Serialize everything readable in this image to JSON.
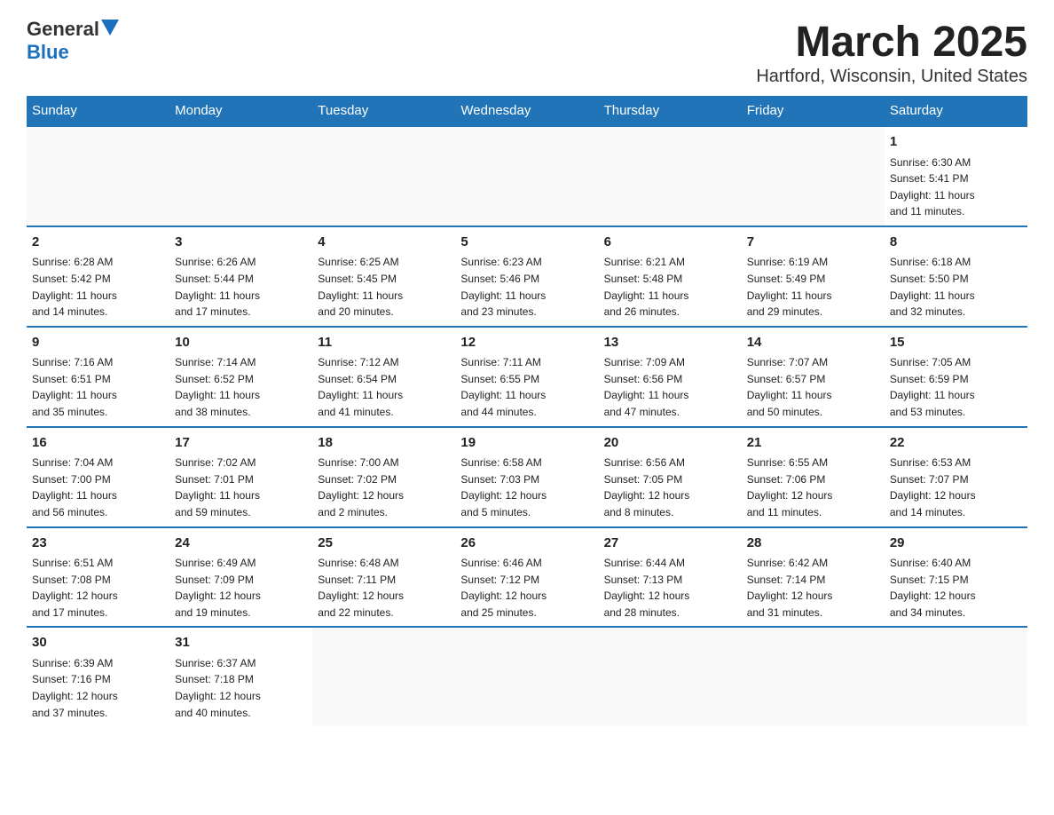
{
  "logo": {
    "general": "General",
    "blue": "Blue"
  },
  "title": "March 2025",
  "subtitle": "Hartford, Wisconsin, United States",
  "days_of_week": [
    "Sunday",
    "Monday",
    "Tuesday",
    "Wednesday",
    "Thursday",
    "Friday",
    "Saturday"
  ],
  "weeks": [
    [
      {
        "num": "",
        "info": ""
      },
      {
        "num": "",
        "info": ""
      },
      {
        "num": "",
        "info": ""
      },
      {
        "num": "",
        "info": ""
      },
      {
        "num": "",
        "info": ""
      },
      {
        "num": "",
        "info": ""
      },
      {
        "num": "1",
        "info": "Sunrise: 6:30 AM\nSunset: 5:41 PM\nDaylight: 11 hours\nand 11 minutes."
      }
    ],
    [
      {
        "num": "2",
        "info": "Sunrise: 6:28 AM\nSunset: 5:42 PM\nDaylight: 11 hours\nand 14 minutes."
      },
      {
        "num": "3",
        "info": "Sunrise: 6:26 AM\nSunset: 5:44 PM\nDaylight: 11 hours\nand 17 minutes."
      },
      {
        "num": "4",
        "info": "Sunrise: 6:25 AM\nSunset: 5:45 PM\nDaylight: 11 hours\nand 20 minutes."
      },
      {
        "num": "5",
        "info": "Sunrise: 6:23 AM\nSunset: 5:46 PM\nDaylight: 11 hours\nand 23 minutes."
      },
      {
        "num": "6",
        "info": "Sunrise: 6:21 AM\nSunset: 5:48 PM\nDaylight: 11 hours\nand 26 minutes."
      },
      {
        "num": "7",
        "info": "Sunrise: 6:19 AM\nSunset: 5:49 PM\nDaylight: 11 hours\nand 29 minutes."
      },
      {
        "num": "8",
        "info": "Sunrise: 6:18 AM\nSunset: 5:50 PM\nDaylight: 11 hours\nand 32 minutes."
      }
    ],
    [
      {
        "num": "9",
        "info": "Sunrise: 7:16 AM\nSunset: 6:51 PM\nDaylight: 11 hours\nand 35 minutes."
      },
      {
        "num": "10",
        "info": "Sunrise: 7:14 AM\nSunset: 6:52 PM\nDaylight: 11 hours\nand 38 minutes."
      },
      {
        "num": "11",
        "info": "Sunrise: 7:12 AM\nSunset: 6:54 PM\nDaylight: 11 hours\nand 41 minutes."
      },
      {
        "num": "12",
        "info": "Sunrise: 7:11 AM\nSunset: 6:55 PM\nDaylight: 11 hours\nand 44 minutes."
      },
      {
        "num": "13",
        "info": "Sunrise: 7:09 AM\nSunset: 6:56 PM\nDaylight: 11 hours\nand 47 minutes."
      },
      {
        "num": "14",
        "info": "Sunrise: 7:07 AM\nSunset: 6:57 PM\nDaylight: 11 hours\nand 50 minutes."
      },
      {
        "num": "15",
        "info": "Sunrise: 7:05 AM\nSunset: 6:59 PM\nDaylight: 11 hours\nand 53 minutes."
      }
    ],
    [
      {
        "num": "16",
        "info": "Sunrise: 7:04 AM\nSunset: 7:00 PM\nDaylight: 11 hours\nand 56 minutes."
      },
      {
        "num": "17",
        "info": "Sunrise: 7:02 AM\nSunset: 7:01 PM\nDaylight: 11 hours\nand 59 minutes."
      },
      {
        "num": "18",
        "info": "Sunrise: 7:00 AM\nSunset: 7:02 PM\nDaylight: 12 hours\nand 2 minutes."
      },
      {
        "num": "19",
        "info": "Sunrise: 6:58 AM\nSunset: 7:03 PM\nDaylight: 12 hours\nand 5 minutes."
      },
      {
        "num": "20",
        "info": "Sunrise: 6:56 AM\nSunset: 7:05 PM\nDaylight: 12 hours\nand 8 minutes."
      },
      {
        "num": "21",
        "info": "Sunrise: 6:55 AM\nSunset: 7:06 PM\nDaylight: 12 hours\nand 11 minutes."
      },
      {
        "num": "22",
        "info": "Sunrise: 6:53 AM\nSunset: 7:07 PM\nDaylight: 12 hours\nand 14 minutes."
      }
    ],
    [
      {
        "num": "23",
        "info": "Sunrise: 6:51 AM\nSunset: 7:08 PM\nDaylight: 12 hours\nand 17 minutes."
      },
      {
        "num": "24",
        "info": "Sunrise: 6:49 AM\nSunset: 7:09 PM\nDaylight: 12 hours\nand 19 minutes."
      },
      {
        "num": "25",
        "info": "Sunrise: 6:48 AM\nSunset: 7:11 PM\nDaylight: 12 hours\nand 22 minutes."
      },
      {
        "num": "26",
        "info": "Sunrise: 6:46 AM\nSunset: 7:12 PM\nDaylight: 12 hours\nand 25 minutes."
      },
      {
        "num": "27",
        "info": "Sunrise: 6:44 AM\nSunset: 7:13 PM\nDaylight: 12 hours\nand 28 minutes."
      },
      {
        "num": "28",
        "info": "Sunrise: 6:42 AM\nSunset: 7:14 PM\nDaylight: 12 hours\nand 31 minutes."
      },
      {
        "num": "29",
        "info": "Sunrise: 6:40 AM\nSunset: 7:15 PM\nDaylight: 12 hours\nand 34 minutes."
      }
    ],
    [
      {
        "num": "30",
        "info": "Sunrise: 6:39 AM\nSunset: 7:16 PM\nDaylight: 12 hours\nand 37 minutes."
      },
      {
        "num": "31",
        "info": "Sunrise: 6:37 AM\nSunset: 7:18 PM\nDaylight: 12 hours\nand 40 minutes."
      },
      {
        "num": "",
        "info": ""
      },
      {
        "num": "",
        "info": ""
      },
      {
        "num": "",
        "info": ""
      },
      {
        "num": "",
        "info": ""
      },
      {
        "num": "",
        "info": ""
      }
    ]
  ]
}
